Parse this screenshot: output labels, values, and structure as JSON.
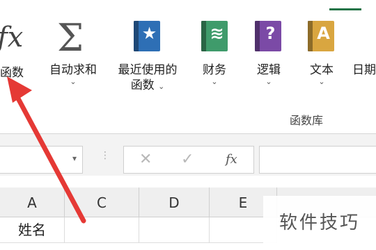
{
  "ribbon": {
    "insert_function": {
      "icon": "fx-icon",
      "glyph": "fx",
      "label": "函数"
    },
    "commands": [
      {
        "id": "autosum",
        "icon": "sigma-icon",
        "line1": "自动求和",
        "chevron": "⌄"
      },
      {
        "id": "recent",
        "icon": "star-book-icon",
        "line1": "最近使用的",
        "line2": "函数",
        "chevron": "⌄",
        "color": "#2e6fb5",
        "glyph": "★"
      },
      {
        "id": "finance",
        "icon": "coins-book-icon",
        "line1": "财务",
        "chevron": "⌄",
        "color": "#3f9b6b",
        "glyph": "≋"
      },
      {
        "id": "logic",
        "icon": "question-book-icon",
        "line1": "逻辑",
        "chevron": "⌄",
        "color": "#7b4aa6",
        "glyph": "?"
      },
      {
        "id": "text",
        "icon": "text-book-icon",
        "line1": "文本",
        "chevron": "⌄",
        "color": "#d9a640",
        "glyph": "A"
      },
      {
        "id": "date",
        "icon": "date-book-icon",
        "line1": "日期"
      }
    ],
    "group_label": "函数库"
  },
  "formula_bar": {
    "cancel_glyph": "✕",
    "enter_glyph": "✓",
    "fx_glyph": "fx",
    "dropdown_glyph": "▾",
    "dots_glyph": "⋮"
  },
  "grid": {
    "columns": [
      "A",
      "C",
      "D",
      "E"
    ],
    "row1": [
      "姓名",
      "",
      "",
      ""
    ]
  },
  "watermark": "软件技巧",
  "colors": {
    "accent": "#217346",
    "arrow": "#e53935"
  }
}
